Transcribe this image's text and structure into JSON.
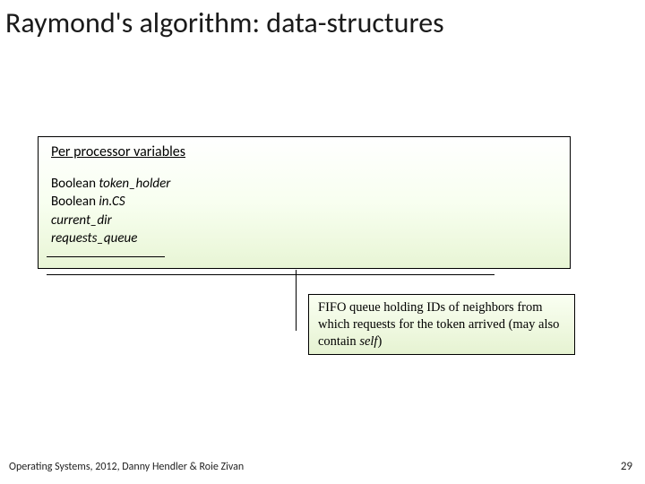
{
  "title": "Raymond's algorithm: data-structures",
  "box": {
    "heading": "Per processor variables",
    "vars": {
      "line1_prefix": "Boolean ",
      "line1_name": "token_holder",
      "line2_prefix": "Boolean ",
      "line2_name": "in.CS",
      "line3_name": "current_dir",
      "line4_name": "requests_queue"
    }
  },
  "callout": {
    "text_before": "FIFO queue holding IDs of neighbors from which requests for the token arrived (may also contain ",
    "self_word": "self",
    "text_after": ")"
  },
  "footer": "Operating Systems, 2012, Danny Hendler & Roie Zivan",
  "page_number": "29"
}
